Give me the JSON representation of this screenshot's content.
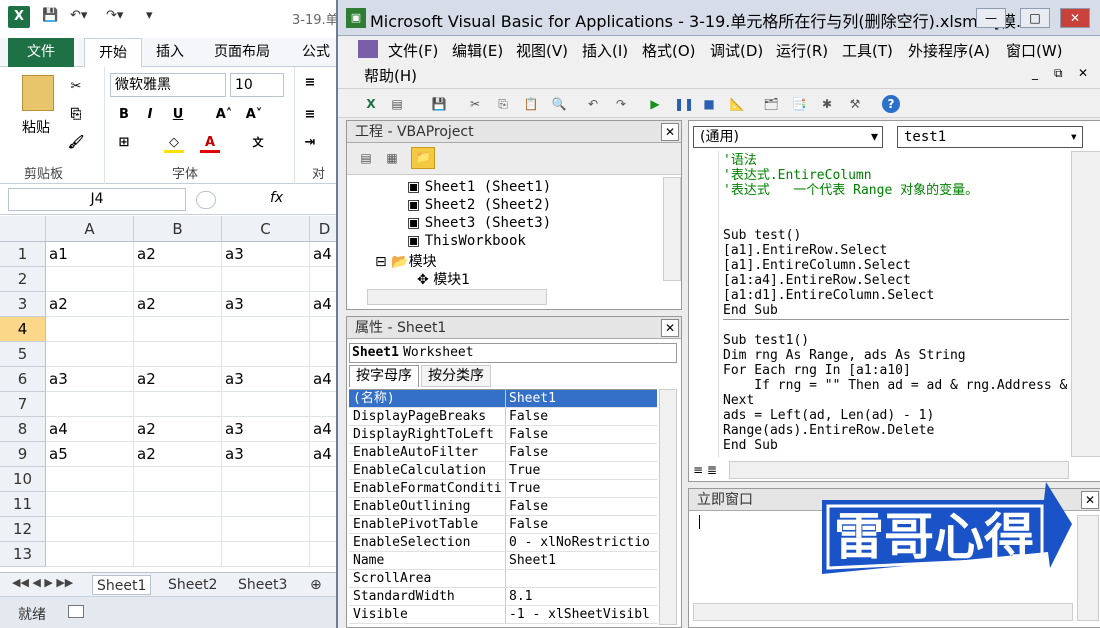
{
  "excel": {
    "doc_title": "3-19.单",
    "tabs": {
      "file": "文件",
      "home": "开始",
      "insert": "插入",
      "layout": "页面布局",
      "formula": "公式"
    },
    "ribbon": {
      "paste": "粘贴",
      "clipboard": "剪贴板",
      "font_name": "微软雅黑",
      "font_size": "10",
      "font_group": "字体",
      "align_group": "对齐"
    },
    "name_box": "J4",
    "fx": "fx",
    "columns": [
      "A",
      "B",
      "C",
      "D"
    ],
    "rows": [
      {
        "n": "1",
        "cells": [
          "a1",
          "a2",
          "a3",
          "a4"
        ]
      },
      {
        "n": "2",
        "cells": [
          "",
          "",
          "",
          ""
        ]
      },
      {
        "n": "3",
        "cells": [
          "a2",
          "a2",
          "a3",
          "a4"
        ]
      },
      {
        "n": "4",
        "cells": [
          "",
          "",
          "",
          ""
        ]
      },
      {
        "n": "5",
        "cells": [
          "",
          "",
          "",
          ""
        ]
      },
      {
        "n": "6",
        "cells": [
          "a3",
          "a2",
          "a3",
          "a4"
        ]
      },
      {
        "n": "7",
        "cells": [
          "",
          "",
          "",
          ""
        ]
      },
      {
        "n": "8",
        "cells": [
          "a4",
          "a2",
          "a3",
          "a4"
        ]
      },
      {
        "n": "9",
        "cells": [
          "a5",
          "a2",
          "a3",
          "a4"
        ]
      },
      {
        "n": "10",
        "cells": [
          "",
          "",
          "",
          ""
        ]
      },
      {
        "n": "11",
        "cells": [
          "",
          "",
          "",
          ""
        ]
      },
      {
        "n": "12",
        "cells": [
          "",
          "",
          "",
          ""
        ]
      },
      {
        "n": "13",
        "cells": [
          "",
          "",
          "",
          ""
        ]
      }
    ],
    "selected_row": "4",
    "sheet_tabs": [
      "Sheet1",
      "Sheet2",
      "Sheet3"
    ],
    "status": "就绪"
  },
  "vba": {
    "title": "Microsoft Visual Basic for Applications - 3-19.单元格所在行与列(删除空行).xlsm - [模...",
    "menus": [
      "文件(F)",
      "编辑(E)",
      "视图(V)",
      "插入(I)",
      "格式(O)",
      "调试(D)",
      "运行(R)",
      "工具(T)",
      "外接程序(A)",
      "窗口(W)",
      "帮助(H)"
    ],
    "project": {
      "title": "工程 - VBAProject",
      "items": [
        "Sheet1 (Sheet1)",
        "Sheet2 (Sheet2)",
        "Sheet3 (Sheet3)",
        "ThisWorkbook",
        "模块",
        "模块1"
      ]
    },
    "props": {
      "title": "属性 - Sheet1",
      "object": "Sheet1",
      "object_type": "Worksheet",
      "tab_alpha": "按字母序",
      "tab_cat": "按分类序",
      "rows": [
        {
          "name": "(名称)",
          "value": "Sheet1"
        },
        {
          "name": "DisplayPageBreaks",
          "value": "False"
        },
        {
          "name": "DisplayRightToLeft",
          "value": "False"
        },
        {
          "name": "EnableAutoFilter",
          "value": "False"
        },
        {
          "name": "EnableCalculation",
          "value": "True"
        },
        {
          "name": "EnableFormatConditi",
          "value": "True"
        },
        {
          "name": "EnableOutlining",
          "value": "False"
        },
        {
          "name": "EnablePivotTable",
          "value": "False"
        },
        {
          "name": "EnableSelection",
          "value": "0 - xlNoRestrictio"
        },
        {
          "name": "Name",
          "value": "Sheet1"
        },
        {
          "name": "ScrollArea",
          "value": ""
        },
        {
          "name": "StandardWidth",
          "value": "8.1"
        },
        {
          "name": "Visible",
          "value": "-1 - xlSheetVisibl"
        }
      ]
    },
    "code": {
      "object_combo": "(通用)",
      "proc_combo": "test1",
      "lines": [
        {
          "t": "'语法",
          "c": "green"
        },
        {
          "t": "'表达式.EntireColumn",
          "c": "green"
        },
        {
          "t": "'表达式   一个代表 Range 对象的变量。",
          "c": "green"
        },
        {
          "t": "",
          "c": ""
        },
        {
          "t": "",
          "c": ""
        },
        {
          "t": "Sub test()",
          "c": ""
        },
        {
          "t": "[a1].EntireRow.Select",
          "c": ""
        },
        {
          "t": "[a1].EntireColumn.Select",
          "c": ""
        },
        {
          "t": "[a1:a4].EntireRow.Select",
          "c": ""
        },
        {
          "t": "[a1:d1].EntireColumn.Select",
          "c": ""
        },
        {
          "t": "End Sub",
          "c": ""
        },
        {
          "t": "",
          "c": ""
        },
        {
          "t": "Sub test1()",
          "c": ""
        },
        {
          "t": "Dim rng As Range, ads As String",
          "c": ""
        },
        {
          "t": "For Each rng In [a1:a10]",
          "c": ""
        },
        {
          "t": "    If rng = \"\" Then ad = ad & rng.Address &",
          "c": ""
        },
        {
          "t": "Next",
          "c": ""
        },
        {
          "t": "ads = Left(ad, Len(ad) - 1)",
          "c": ""
        },
        {
          "t": "Range(ads).EntireRow.Delete",
          "c": ""
        },
        {
          "t": "End Sub",
          "c": ""
        }
      ]
    },
    "immediate_title": "立即窗口"
  },
  "watermark": "雷哥心得",
  "colors": {
    "excel_green": "#1e7145",
    "selected_row": "#fbd889",
    "comment": "#008000",
    "watermark_blue": "#1a53c8"
  }
}
